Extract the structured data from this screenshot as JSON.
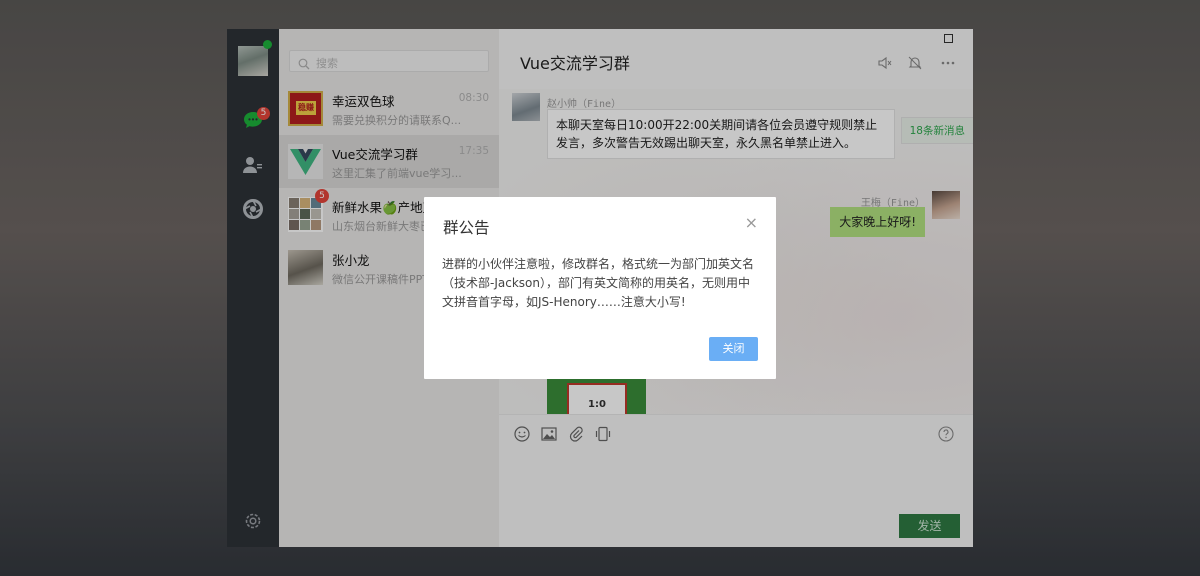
{
  "colors": {
    "nav_bg": "#2e3238",
    "list_bg": "#eae8e7",
    "active_row": "#dad9d8",
    "badge": "#e5443a",
    "own_bubble": "#b2e281",
    "send_button": "#2f7a43",
    "dialog_button": "#6aaef5",
    "new_msg_text": "#2ea84e"
  },
  "nav": {
    "items": [
      {
        "icon": "chat-icon",
        "badge": "5"
      },
      {
        "icon": "contacts-icon"
      },
      {
        "icon": "moments-icon"
      },
      {
        "icon": "settings-icon"
      }
    ]
  },
  "search": {
    "placeholder": "搜索"
  },
  "conversations": [
    {
      "name": "幸运双色球",
      "time": "08:30",
      "preview": "需要兑换积分的请联系Q...",
      "avatar_text": "稳赚"
    },
    {
      "name": "Vue交流学习群",
      "time": "17:35",
      "preview": "这里汇集了前端vue学习...",
      "active": true
    },
    {
      "name": "新鲜水果🍏产地直",
      "time": "",
      "preview": "山东烟台新鲜大枣已",
      "badge": "5"
    },
    {
      "name": "张小龙",
      "time": "",
      "preview": "微信公开课稿件PPT"
    }
  ],
  "chat": {
    "title": "Vue交流学习群",
    "header_icons": [
      "speaker-icon",
      "mute-bell-icon",
      "more-icon"
    ],
    "new_messages": "18条新消息",
    "messages": [
      {
        "sender": "赵小帅（Fine）",
        "text": "本聊天室每日10:00开22:00关期间请各位会员遵守规则禁止发言，多次警告无效踢出聊天室，永久黑名单禁止进入。"
      },
      {
        "sender": "王梅（Fine）",
        "text": "大家晚上好呀!"
      }
    ],
    "image_score": "1:0",
    "toolbar_icons": [
      "emoji-icon",
      "image-icon",
      "attachment-icon",
      "shake-icon",
      "help-icon"
    ],
    "send_label": "发送"
  },
  "dialog": {
    "title": "群公告",
    "close_symbol": "×",
    "body": "进群的小伙伴注意啦，修改群名，格式统一为部门加英文名（技术部-Jackson），部门有英文简称的用英名，无则用中文拼音首字母，如JS-Henory……注意大小写!",
    "button": "关闭"
  }
}
